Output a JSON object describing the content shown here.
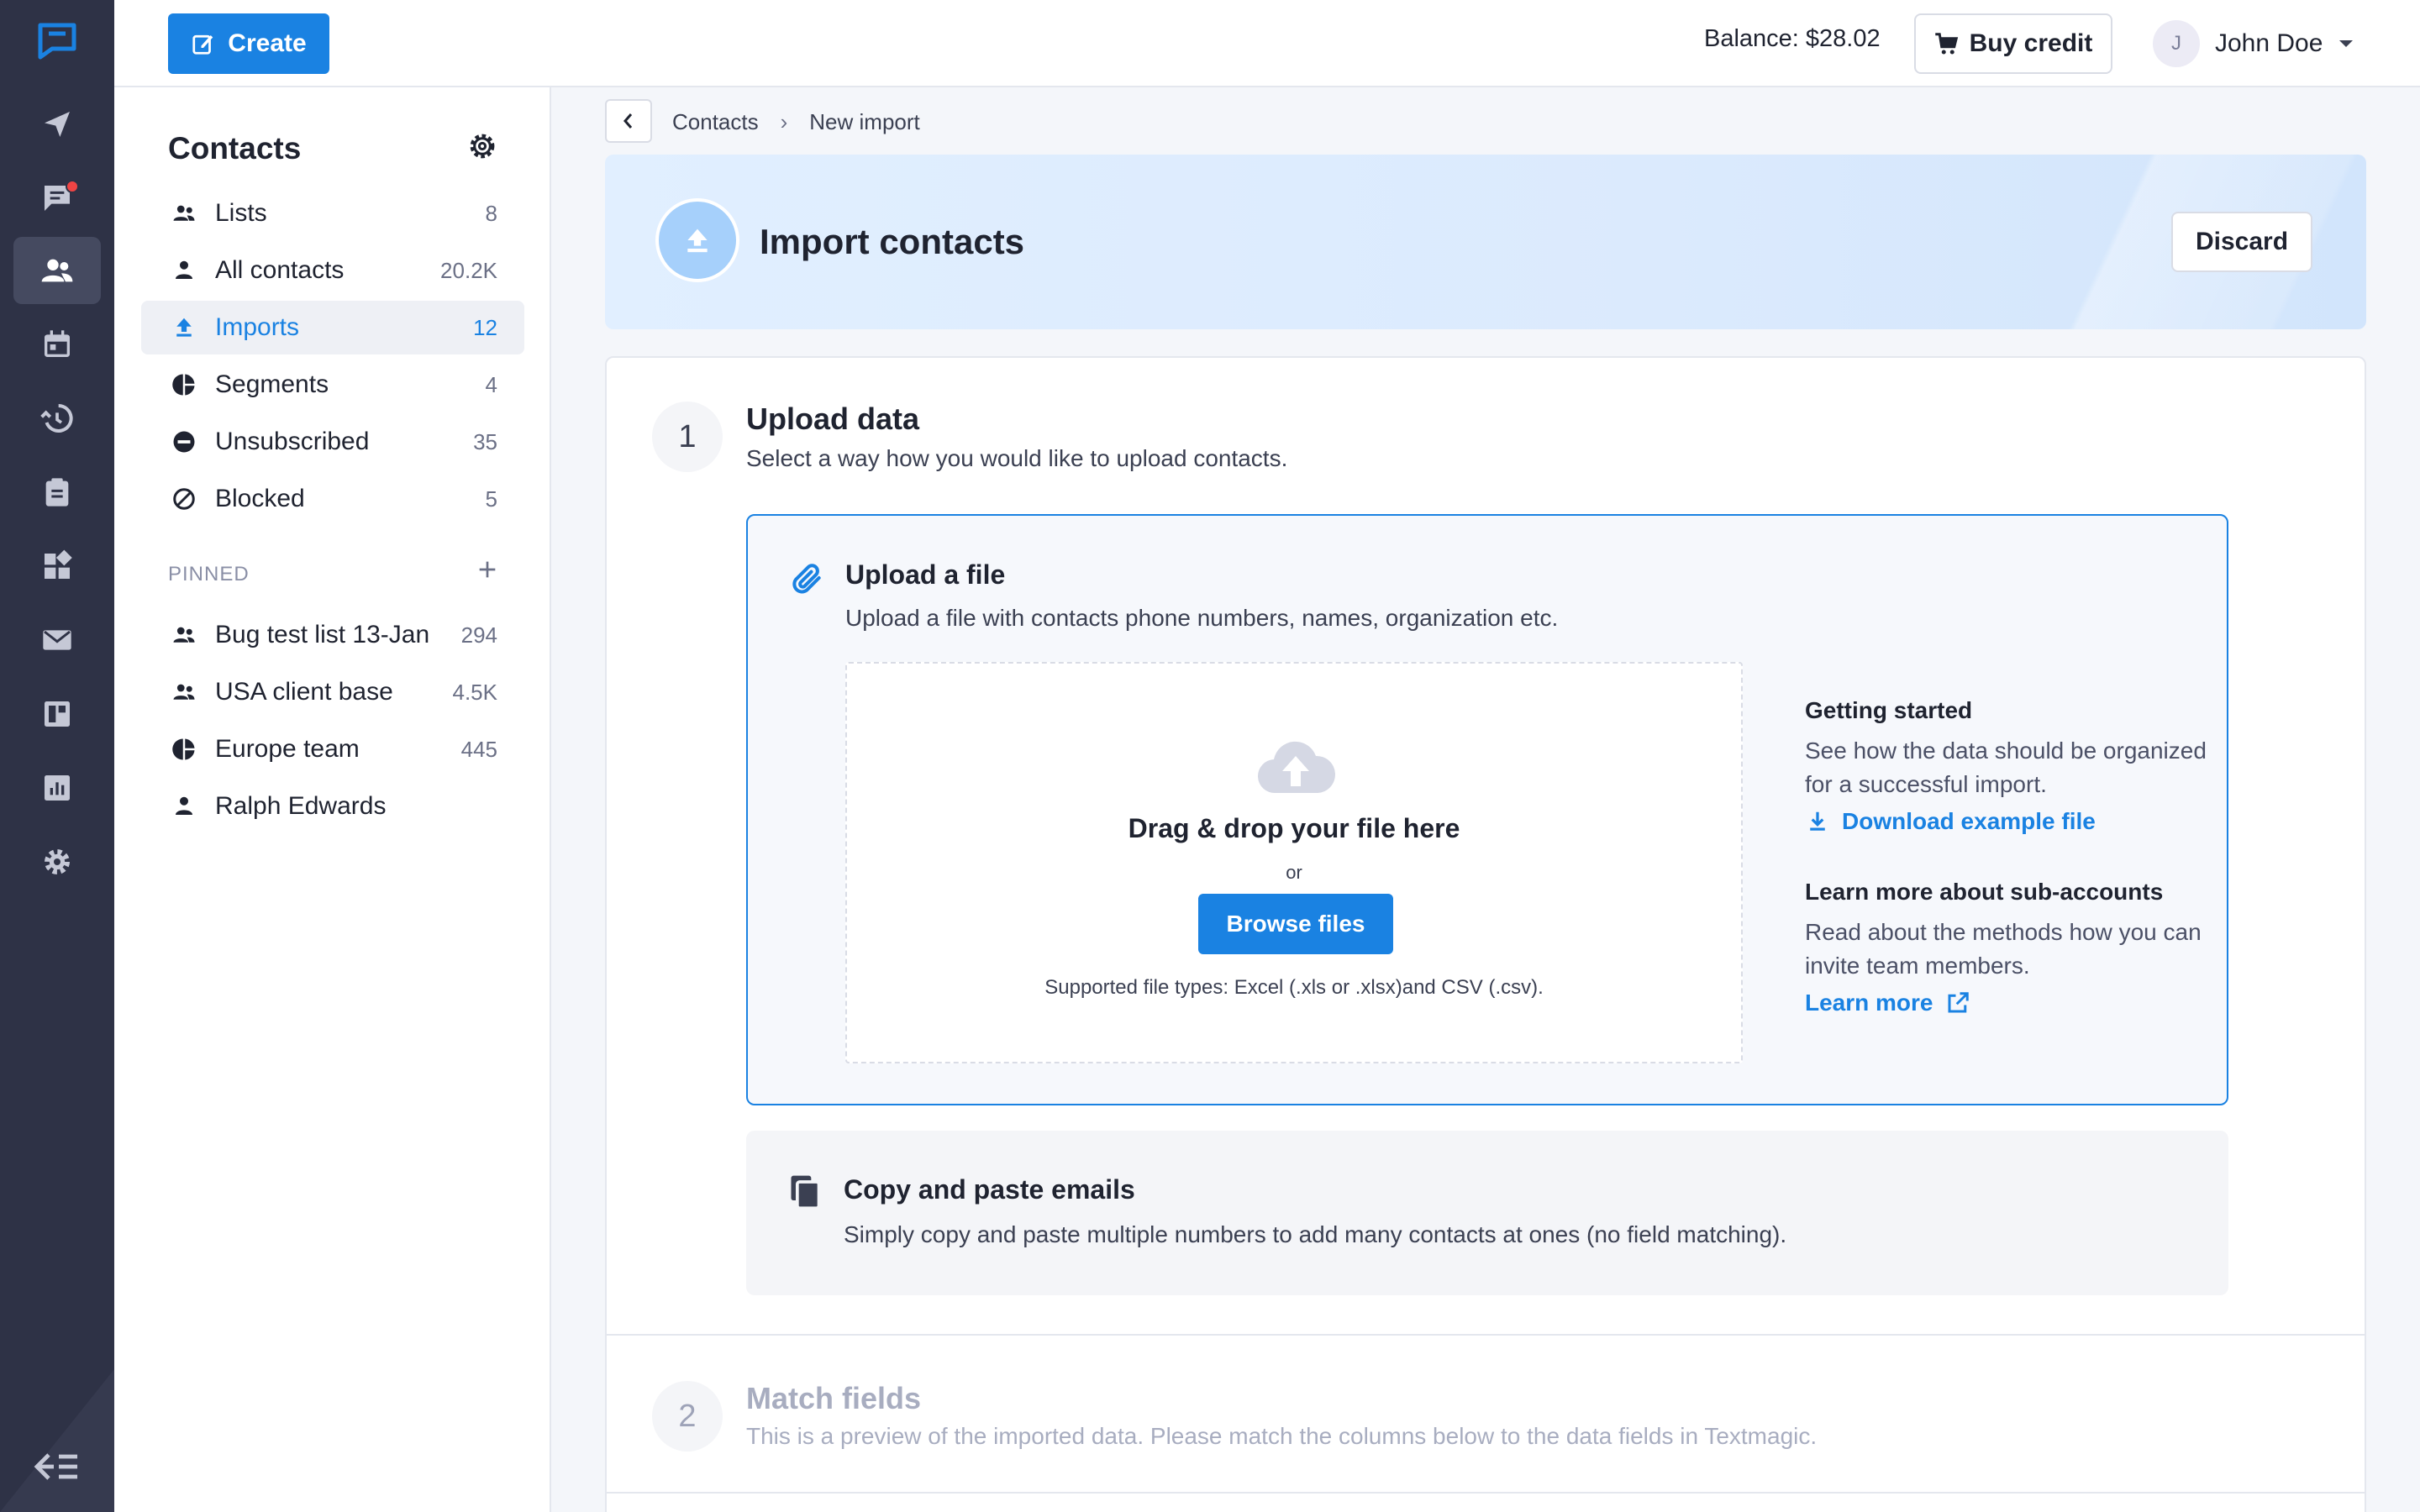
{
  "topbar": {
    "create_label": "Create",
    "balance": "Balance: $28.02",
    "buy_label": "Buy credit",
    "user_initial": "J",
    "user_name": "John Doe"
  },
  "rail": {
    "items": [
      "send-icon",
      "chat-icon",
      "contacts-icon",
      "calendar-icon",
      "history-icon",
      "clipboard-icon",
      "apps-icon",
      "mail-icon",
      "board-icon",
      "analytics-icon",
      "settings-icon"
    ],
    "active": "contacts-icon",
    "has_notification": "chat-icon"
  },
  "sidebar": {
    "title": "Contacts",
    "items": [
      {
        "label": "Lists",
        "count": "8",
        "icon": "people-icon"
      },
      {
        "label": "All contacts",
        "count": "20.2K",
        "icon": "person-icon"
      },
      {
        "label": "Imports",
        "count": "12",
        "icon": "upload-icon",
        "active": true
      },
      {
        "label": "Segments",
        "count": "4",
        "icon": "pie-icon"
      },
      {
        "label": "Unsubscribed",
        "count": "35",
        "icon": "minus-circle-icon"
      },
      {
        "label": "Blocked",
        "count": "5",
        "icon": "block-icon"
      }
    ],
    "pinned_header": "PINNED",
    "pinned": [
      {
        "label": "Bug test list 13-Jan",
        "count": "294",
        "icon": "people-icon"
      },
      {
        "label": "USA client base",
        "count": "4.5K",
        "icon": "people-icon"
      },
      {
        "label": "Europe team",
        "count": "445",
        "icon": "pie-icon"
      },
      {
        "label": "Ralph Edwards",
        "count": "",
        "icon": "person-icon"
      }
    ]
  },
  "breadcrumb": {
    "items": [
      "Contacts",
      "New import"
    ],
    "separator": "›"
  },
  "banner": {
    "title": "Import contacts",
    "discard_label": "Discard"
  },
  "step1": {
    "number": "1",
    "title": "Upload data",
    "subtitle": "Select a way how you would like to upload contacts.",
    "upload_file": {
      "title": "Upload a file",
      "desc": "Upload a file with contacts phone numbers, names, organization etc.",
      "drop_title": "Drag & drop your file here",
      "or": "or",
      "browse_label": "Browse files",
      "types": "Supported file types: Excel (.xls or .xlsx)and CSV (.csv)."
    },
    "getting_started": {
      "title": "Getting started",
      "text": "See how the data should be organized for a successful import.",
      "link": "Download example file"
    },
    "learn_more": {
      "title": "Learn more about sub-accounts",
      "text": "Read about the methods how you can invite team members.",
      "link": "Learn more"
    },
    "copy_paste": {
      "title": "Copy and paste emails",
      "desc": "Simply copy and paste multiple numbers to add many contacts at ones (no field matching)."
    }
  },
  "step2": {
    "number": "2",
    "title": "Match fields",
    "subtitle": "This is a preview of the imported data. Please match the columns below to the data fields in Textmagic."
  },
  "colors": {
    "accent": "#1a82e2",
    "rail": "#2e3246"
  }
}
